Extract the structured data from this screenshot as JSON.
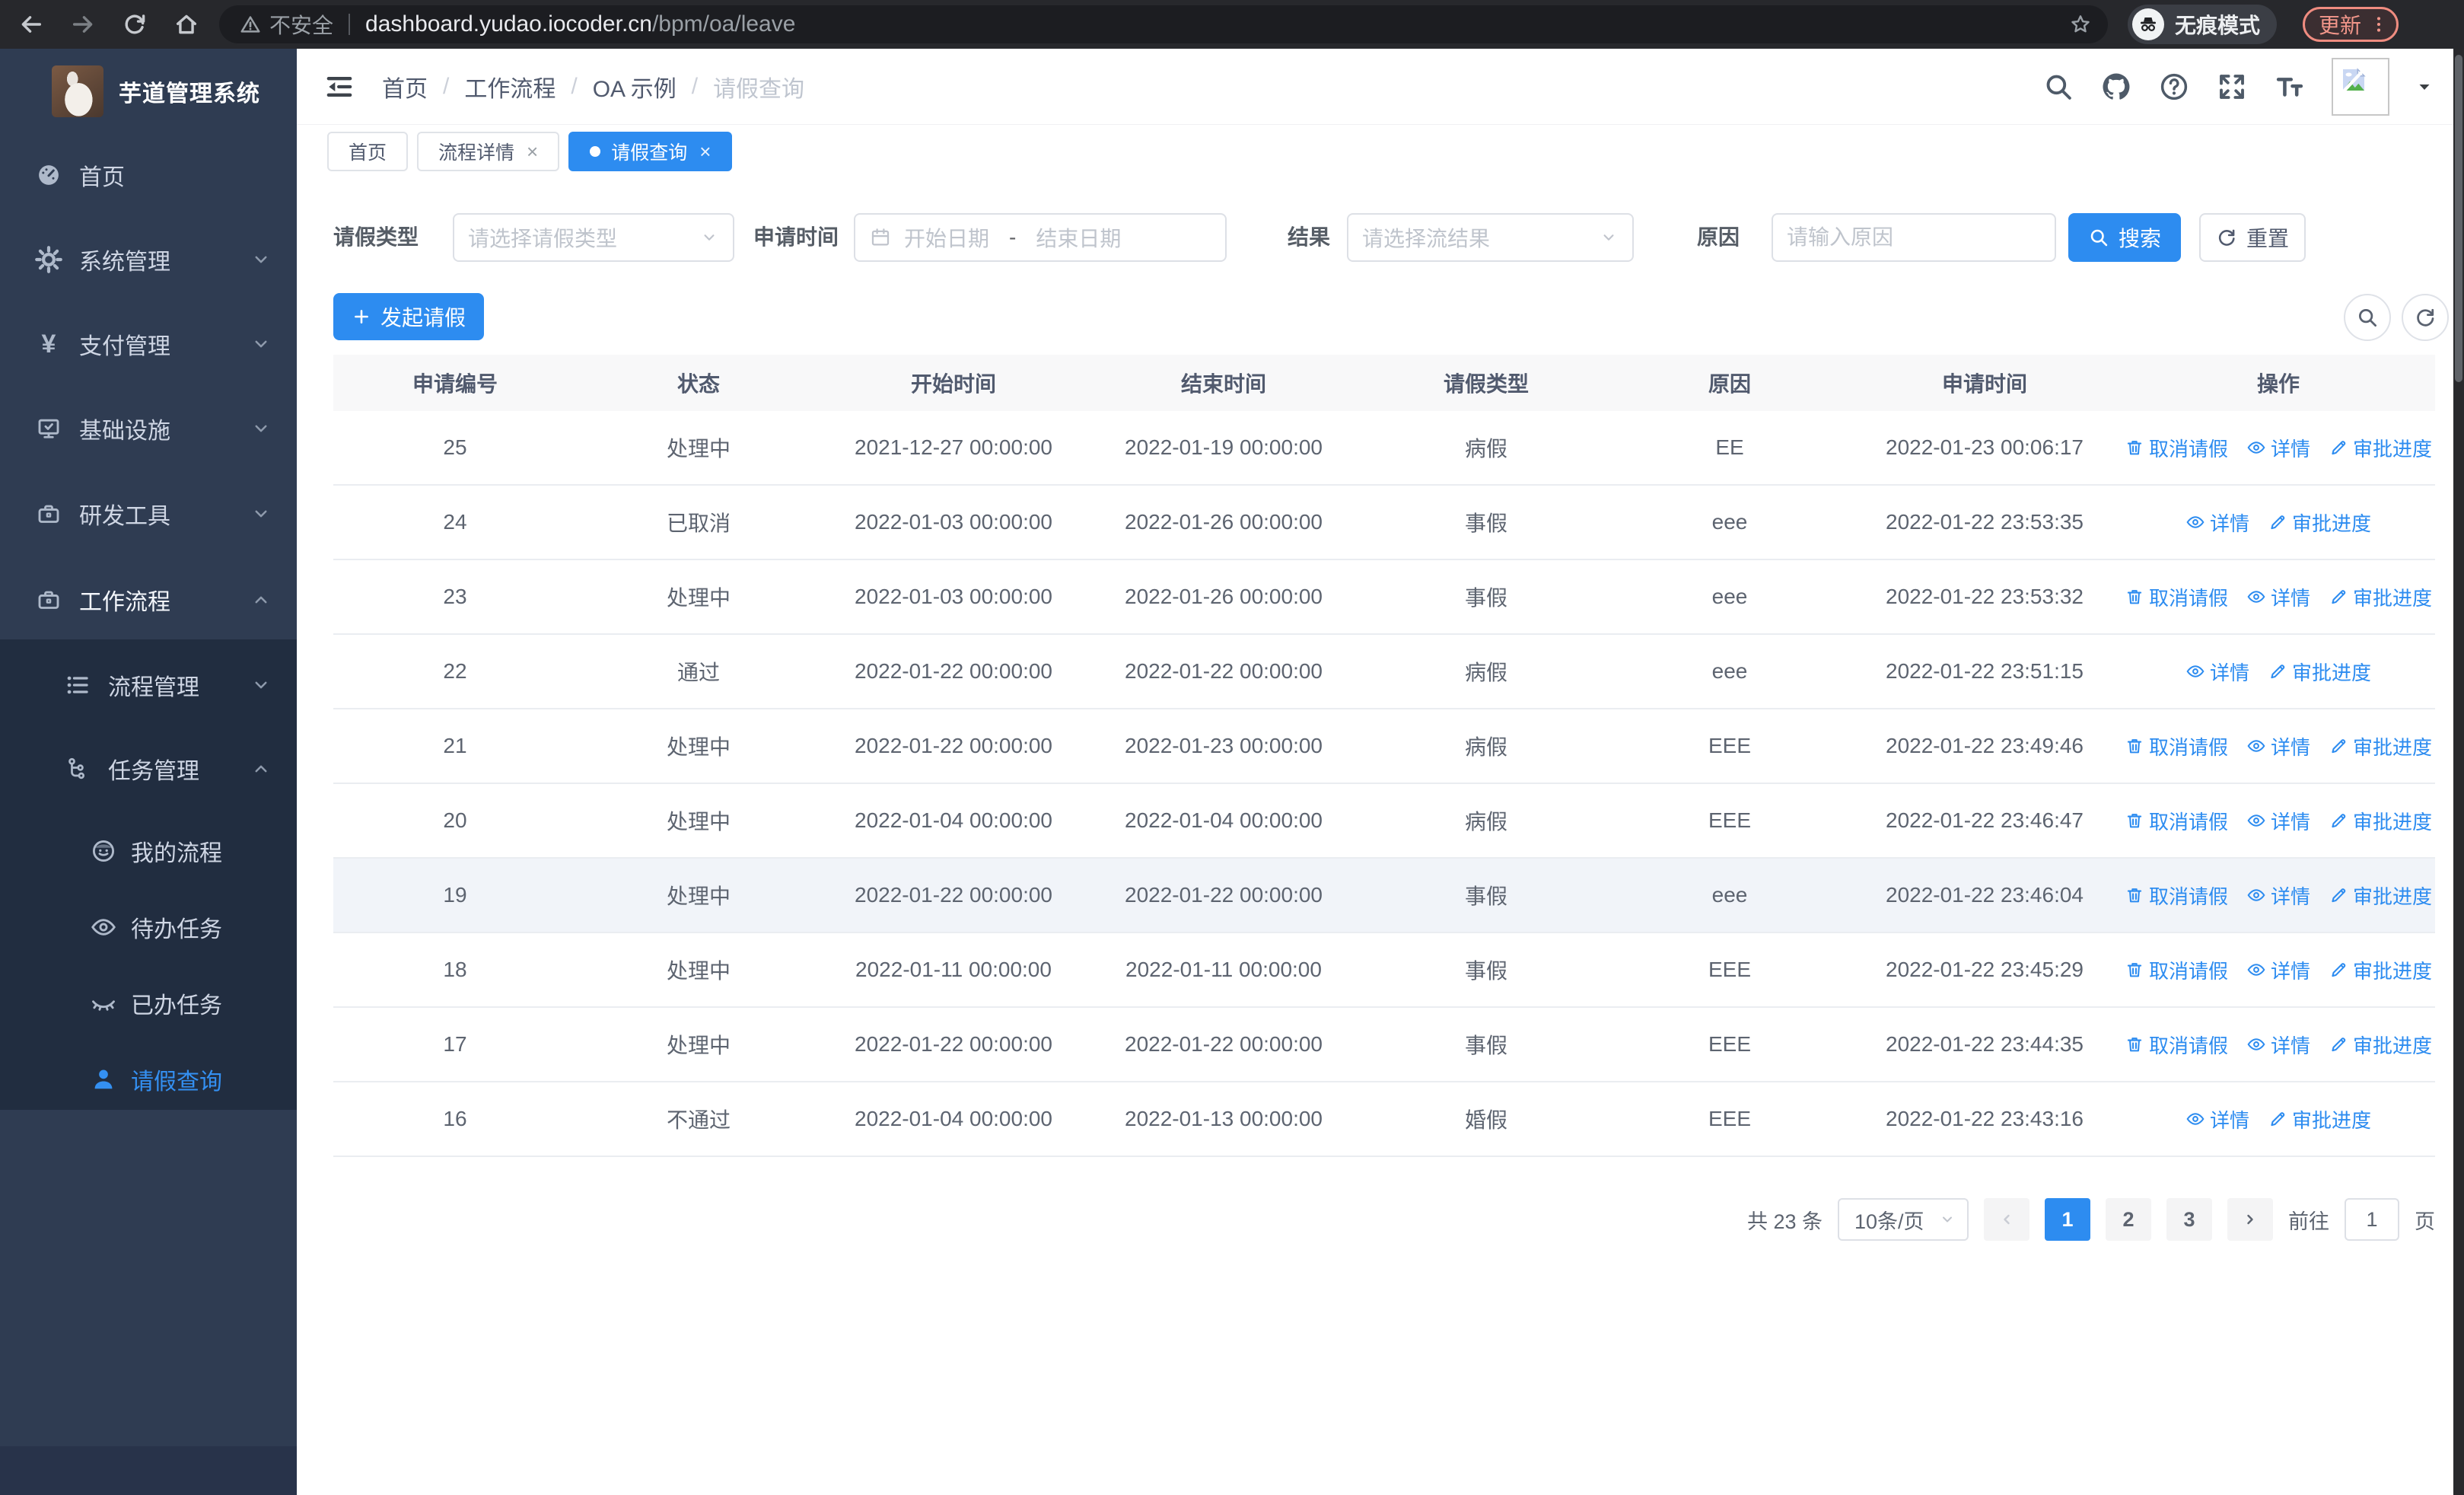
{
  "colors": {
    "accent": "#2d8cf0",
    "sidebar_bg": "#2f3c52",
    "sidebar_submenu_bg": "#212d40",
    "update_button": "#f28b82",
    "table_header_bg": "#f8f8f9"
  },
  "icons": {
    "back-icon": "left arrow",
    "forward-icon": "right arrow",
    "reload-icon": "circular arrow",
    "home-icon": "house",
    "warning-icon": "triangle !",
    "star-icon": "bookmark star",
    "incognito-icon": "hat and glasses",
    "more-icon": "vertical dots",
    "collapse-menu-icon": "indent lines",
    "search-icon": "magnifier",
    "github-icon": "octocat",
    "help-icon": "? in circle",
    "fullscreen-icon": "corner arrows",
    "font-size-icon": "tT",
    "avatar-placeholder-icon": "broken image",
    "chevron-down-icon": "v",
    "chevron-up-icon": "^",
    "calendar-icon": "calendar",
    "plus-icon": "+",
    "refresh-icon": "circular arrows",
    "delete-icon": "trash can",
    "view-icon": "eye",
    "edit-icon": "pen",
    "dashboard-icon": "gauge",
    "gear-icon": "cog",
    "yen-icon": "¥",
    "monitor-icon": "screen with check",
    "toolbox-icon": "briefcase",
    "list-icon": "indented list",
    "flow-icon": "branch nodes",
    "face-icon": "smiling face",
    "eye-open-icon": "open eye",
    "eye-closed-icon": "closed eye",
    "person-icon": "user silhouette"
  },
  "browser": {
    "security_label": "不安全",
    "url_host": "dashboard.yudao.iocoder.cn",
    "url_path": "/bpm/oa/leave",
    "incognito_label": "无痕模式",
    "update_label": "更新"
  },
  "sidebar": {
    "title": "芋道管理系统",
    "menu": [
      {
        "label": "首页",
        "icon": "dashboard-icon"
      },
      {
        "label": "系统管理",
        "icon": "gear-icon",
        "chevron": "down"
      },
      {
        "label": "支付管理",
        "icon": "yen-icon",
        "chevron": "down"
      },
      {
        "label": "基础设施",
        "icon": "monitor-icon",
        "chevron": "down"
      },
      {
        "label": "研发工具",
        "icon": "toolbox-icon",
        "chevron": "down"
      },
      {
        "label": "工作流程",
        "icon": "toolbox-icon",
        "chevron": "up",
        "expanded": true
      },
      {
        "label": "流程管理",
        "icon": "list-icon",
        "chevron": "down",
        "level": 2
      },
      {
        "label": "任务管理",
        "icon": "flow-icon",
        "chevron": "up",
        "level": 2,
        "expanded": true
      },
      {
        "label": "我的流程",
        "icon": "face-icon",
        "level": 3
      },
      {
        "label": "待办任务",
        "icon": "eye-open-icon",
        "level": 3
      },
      {
        "label": "已办任务",
        "icon": "eye-closed-icon",
        "level": 3
      },
      {
        "label": "请假查询",
        "icon": "person-icon",
        "level": 3,
        "active": true
      }
    ]
  },
  "header": {
    "breadcrumb": [
      "首页",
      "工作流程",
      "OA 示例",
      "请假查询"
    ],
    "breadcrumb_separator": "/"
  },
  "tabs": {
    "close_glyph": "×",
    "items": [
      {
        "label": "首页",
        "closable": false,
        "active": false
      },
      {
        "label": "流程详情",
        "closable": true,
        "active": false
      },
      {
        "label": "请假查询",
        "closable": true,
        "active": true
      }
    ]
  },
  "filters": {
    "leave_type_label": "请假类型",
    "leave_type_placeholder": "请选择请假类型",
    "apply_time_label": "申请时间",
    "start_placeholder": "开始日期",
    "range_separator": "-",
    "end_placeholder": "结束日期",
    "result_label": "结果",
    "result_placeholder": "请选择流结果",
    "reason_label": "原因",
    "reason_placeholder": "请输入原因",
    "search_label": "搜索",
    "reset_label": "重置"
  },
  "toolbar": {
    "create_label": "发起请假"
  },
  "table": {
    "columns": [
      "申请编号",
      "状态",
      "开始时间",
      "结束时间",
      "请假类型",
      "原因",
      "申请时间",
      "操作"
    ],
    "action_labels": {
      "cancel": "取消请假",
      "detail": "详情",
      "progress": "审批进度"
    },
    "rows": [
      {
        "id": "25",
        "status": "处理中",
        "start": "2021-12-27 00:00:00",
        "end": "2022-01-19 00:00:00",
        "type": "病假",
        "reason": "EE",
        "apply_time": "2022-01-23 00:06:17",
        "has_cancel": true
      },
      {
        "id": "24",
        "status": "已取消",
        "start": "2022-01-03 00:00:00",
        "end": "2022-01-26 00:00:00",
        "type": "事假",
        "reason": "eee",
        "apply_time": "2022-01-22 23:53:35",
        "has_cancel": false
      },
      {
        "id": "23",
        "status": "处理中",
        "start": "2022-01-03 00:00:00",
        "end": "2022-01-26 00:00:00",
        "type": "事假",
        "reason": "eee",
        "apply_time": "2022-01-22 23:53:32",
        "has_cancel": true
      },
      {
        "id": "22",
        "status": "通过",
        "start": "2022-01-22 00:00:00",
        "end": "2022-01-22 00:00:00",
        "type": "病假",
        "reason": "eee",
        "apply_time": "2022-01-22 23:51:15",
        "has_cancel": false
      },
      {
        "id": "21",
        "status": "处理中",
        "start": "2022-01-22 00:00:00",
        "end": "2022-01-23 00:00:00",
        "type": "病假",
        "reason": "EEE",
        "apply_time": "2022-01-22 23:49:46",
        "has_cancel": true
      },
      {
        "id": "20",
        "status": "处理中",
        "start": "2022-01-04 00:00:00",
        "end": "2022-01-04 00:00:00",
        "type": "病假",
        "reason": "EEE",
        "apply_time": "2022-01-22 23:46:47",
        "has_cancel": true
      },
      {
        "id": "19",
        "status": "处理中",
        "start": "2022-01-22 00:00:00",
        "end": "2022-01-22 00:00:00",
        "type": "事假",
        "reason": "eee",
        "apply_time": "2022-01-22 23:46:04",
        "has_cancel": true,
        "highlighted": true
      },
      {
        "id": "18",
        "status": "处理中",
        "start": "2022-01-11 00:00:00",
        "end": "2022-01-11 00:00:00",
        "type": "事假",
        "reason": "EEE",
        "apply_time": "2022-01-22 23:45:29",
        "has_cancel": true
      },
      {
        "id": "17",
        "status": "处理中",
        "start": "2022-01-22 00:00:00",
        "end": "2022-01-22 00:00:00",
        "type": "事假",
        "reason": "EEE",
        "apply_time": "2022-01-22 23:44:35",
        "has_cancel": true
      },
      {
        "id": "16",
        "status": "不通过",
        "start": "2022-01-04 00:00:00",
        "end": "2022-01-13 00:00:00",
        "type": "婚假",
        "reason": "EEE",
        "apply_time": "2022-01-22 23:43:16",
        "has_cancel": false
      }
    ]
  },
  "pagination": {
    "total": "共 23 条",
    "page_size": "10条/页",
    "pages": [
      "1",
      "2",
      "3"
    ],
    "active_page": "1",
    "goto_label": "前往",
    "goto_value": "1",
    "goto_suffix": "页"
  }
}
